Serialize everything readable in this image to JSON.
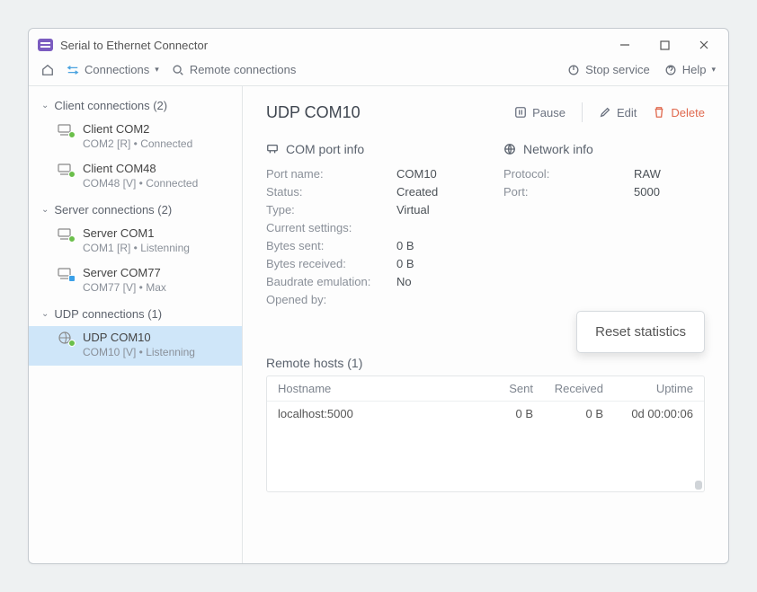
{
  "title": "Serial to Ethernet Connector",
  "toolbar": {
    "connections": "Connections",
    "remote": "Remote connections",
    "stop": "Stop service",
    "help": "Help"
  },
  "sidebar": {
    "groups": [
      {
        "label": "Client connections (2)",
        "items": [
          {
            "name": "Client COM2",
            "sub": "COM2 [R] • Connected",
            "dot": "green"
          },
          {
            "name": "Client COM48",
            "sub": "COM48 [V] • Connected",
            "dot": "green"
          }
        ]
      },
      {
        "label": "Server connections (2)",
        "items": [
          {
            "name": "Server COM1",
            "sub": "COM1 [R] • Listenning",
            "dot": "green-sq"
          },
          {
            "name": "Server COM77",
            "sub": "COM77 [V] • Max",
            "dot": "blue"
          }
        ]
      },
      {
        "label": "UDP connections (1)",
        "items": [
          {
            "name": "UDP COM10",
            "sub": "COM10 [V] • Listenning",
            "dot": "green",
            "selected": true
          }
        ]
      }
    ]
  },
  "main": {
    "title": "UDP COM10",
    "actions": {
      "pause": "Pause",
      "edit": "Edit",
      "delete": "Delete"
    },
    "com_info": {
      "heading": "COM port info",
      "rows": [
        {
          "k": "Port name:",
          "v": "COM10"
        },
        {
          "k": "Status:",
          "v": "Created"
        },
        {
          "k": "Type:",
          "v": "Virtual"
        },
        {
          "k": "Current settings:",
          "v": ""
        },
        {
          "k": "Bytes sent:",
          "v": "0 B"
        },
        {
          "k": "Bytes received:",
          "v": "0 B"
        },
        {
          "k": "Baudrate emulation:",
          "v": "No"
        },
        {
          "k": "Opened by:",
          "v": ""
        }
      ]
    },
    "net_info": {
      "heading": "Network info",
      "rows": [
        {
          "k": "Protocol:",
          "v": "RAW"
        },
        {
          "k": "Port:",
          "v": "5000"
        }
      ]
    },
    "remote_hosts": {
      "heading": "Remote hosts (1)",
      "headers": {
        "host": "Hostname",
        "sent": "Sent",
        "recv": "Received",
        "uptime": "Uptime"
      },
      "rows": [
        {
          "host": "localhost:5000",
          "sent": "0 B",
          "recv": "0 B",
          "uptime": "0d 00:00:06"
        }
      ]
    },
    "popup": "Reset statistics"
  }
}
